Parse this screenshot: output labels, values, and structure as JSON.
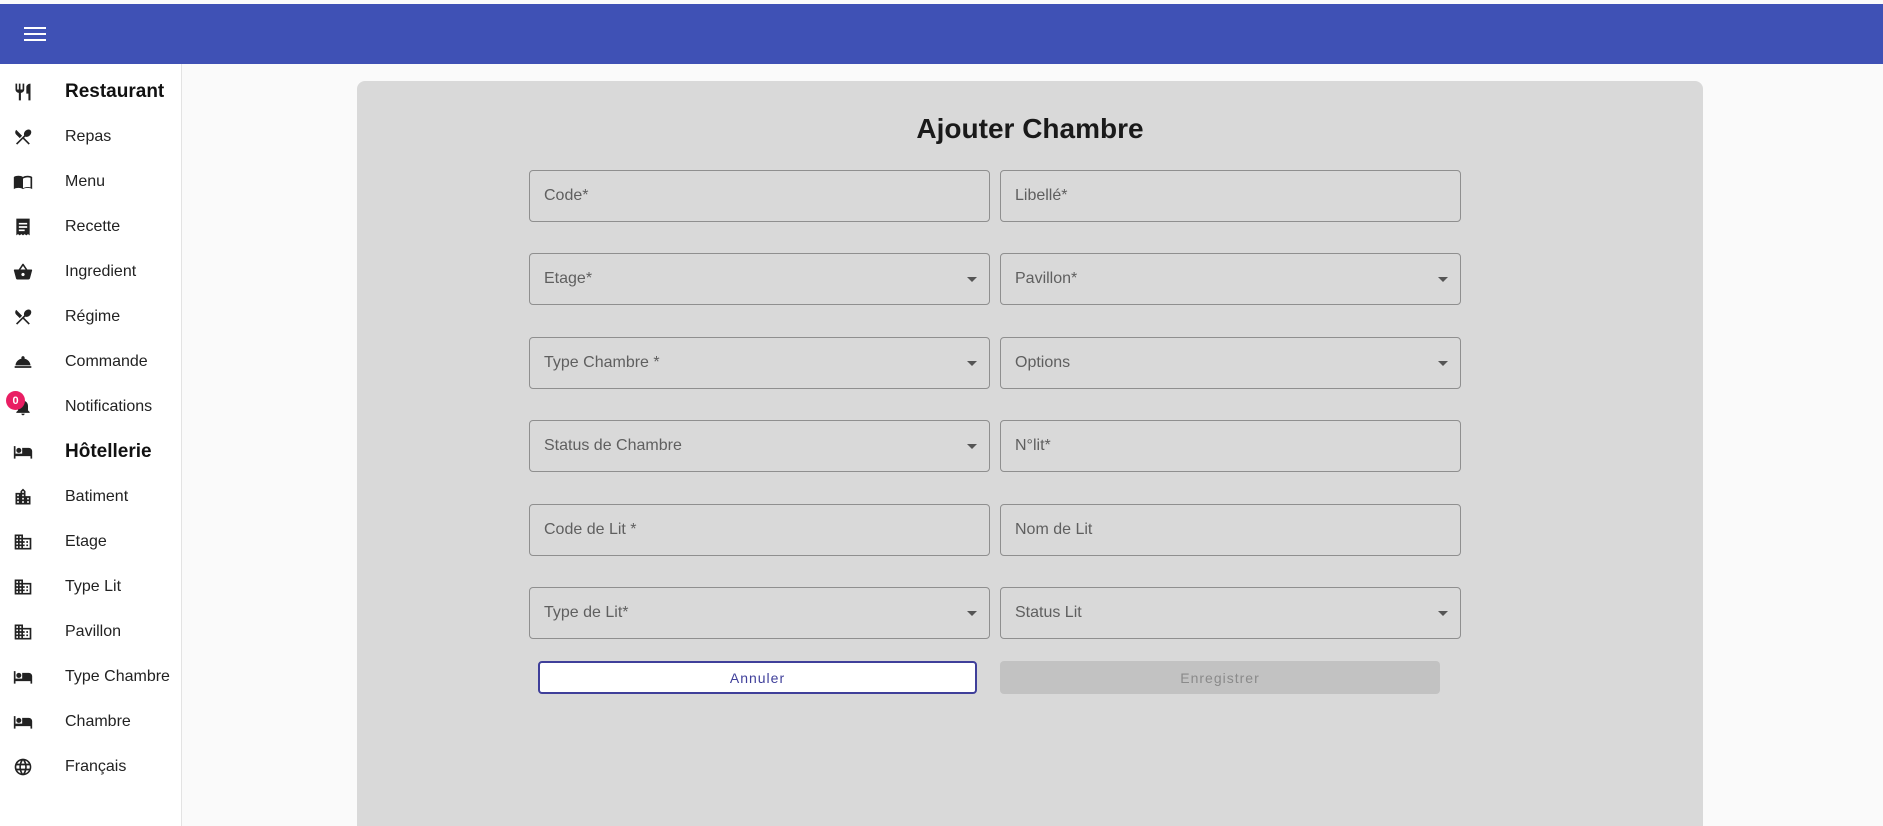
{
  "header": {
    "menu_icon": "menu-icon"
  },
  "sidebar": {
    "items": [
      {
        "label": "Restaurant",
        "icon": "fork-knife-icon",
        "section": true
      },
      {
        "label": "Repas",
        "icon": "utensils-crossed-icon"
      },
      {
        "label": "Menu",
        "icon": "menu-book-icon"
      },
      {
        "label": "Recette",
        "icon": "receipt-icon"
      },
      {
        "label": "Ingredient",
        "icon": "basket-icon"
      },
      {
        "label": "Régime",
        "icon": "utensils-crossed-icon"
      },
      {
        "label": "Commande",
        "icon": "cloche-icon"
      },
      {
        "label": "Notifications",
        "icon": "bell-icon",
        "badge": "0"
      },
      {
        "label": "Hôtellerie",
        "icon": "bed-icon",
        "section": true
      },
      {
        "label": "Batiment",
        "icon": "city-icon"
      },
      {
        "label": "Etage",
        "icon": "building-icon"
      },
      {
        "label": "Type Lit",
        "icon": "building-icon"
      },
      {
        "label": "Pavillon",
        "icon": "building-icon"
      },
      {
        "label": "Type Chambre",
        "icon": "bed-icon"
      },
      {
        "label": "Chambre",
        "icon": "bed-icon"
      },
      {
        "label": "Français",
        "icon": "globe-icon"
      }
    ]
  },
  "form": {
    "title": "Ajouter Chambre",
    "code": "Code*",
    "libelle": "Libellé*",
    "etage": "Etage*",
    "pavillon": "Pavillon*",
    "type_chambre": "Type Chambre *",
    "options": "Options",
    "status_chambre": "Status de Chambre",
    "n_lit": "N°lit*",
    "code_lit": "Code de Lit *",
    "nom_lit": "Nom de Lit",
    "type_lit": "Type de Lit*",
    "status_lit": "Status Lit",
    "cancel_label": "Annuler",
    "save_label": "Enregistrer"
  },
  "colors": {
    "header": "#3f51b5",
    "card": "#d9d9d9",
    "badge": "#e91e63",
    "cancel_border": "#3f3f9a"
  }
}
